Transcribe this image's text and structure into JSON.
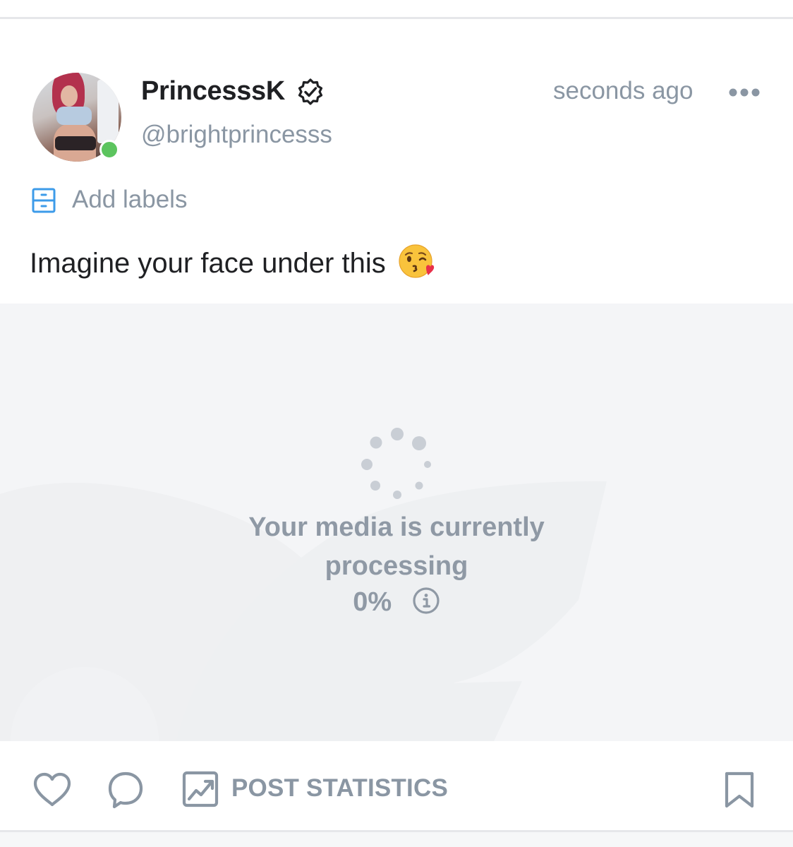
{
  "post": {
    "author": {
      "display_name": "PrincesssK",
      "handle": "@brightprincesss",
      "verified": true,
      "online": true
    },
    "timestamp": "seconds ago",
    "labels_button": "Add labels",
    "text": "Imagine your face under this",
    "emoji": "face-blowing-a-kiss"
  },
  "media": {
    "status_line1": "Your media is currently",
    "status_line2": "processing",
    "progress_text": "0%",
    "progress_value": 0
  },
  "actions": {
    "post_statistics_label": "POST STATISTICS"
  },
  "colors": {
    "muted_text": "#8a96a3",
    "primary_text": "#1f2023",
    "online": "#5cc45e",
    "label_icon": "#3d9be9",
    "media_bg": "#f4f5f7"
  }
}
